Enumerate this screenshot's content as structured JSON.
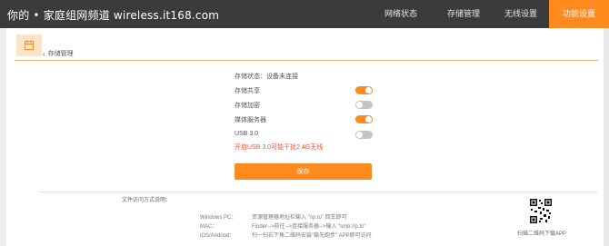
{
  "watermark": "你的 • 家庭组网频道 wireless.it168.com",
  "nav": {
    "tabs": [
      {
        "label": "网络状态"
      },
      {
        "label": "存储管理"
      },
      {
        "label": "无线设置"
      },
      {
        "label": "功能设置"
      }
    ],
    "active_index": 3
  },
  "breadcrumb": {
    "label": "存储管理"
  },
  "status": {
    "label": "存储状态：设备未连接"
  },
  "settings": [
    {
      "label": "存储共享",
      "enabled": true
    },
    {
      "label": "存储加密",
      "enabled": false
    },
    {
      "label": "媒体服务器",
      "enabled": true
    },
    {
      "label": "USB 3.0",
      "enabled": false
    }
  ],
  "usb_warning": "开启USB 3.0可能干扰2.4G无线",
  "save_label": "保存",
  "access": {
    "title": "文件访问方式说明：",
    "rows": [
      {
        "platform": "Windows PC：",
        "desc": "资源管理器地址栏输入 “\\\\p.to” 回车即可"
      },
      {
        "platform": "MAC：",
        "desc": "Finder-->前往-->连接服务器-->输入 “smb://p.to”"
      },
      {
        "platform": "iOS/Andriod：",
        "desc": "扫一扫右下角二维码安装“猫先跑步” APP即可访问"
      }
    ]
  },
  "qr_caption": "扫描二维码下载APP",
  "colors": {
    "accent": "#ff8a1e",
    "nav_bg": "#3b3b3b",
    "warning": "#ff4d2e"
  }
}
